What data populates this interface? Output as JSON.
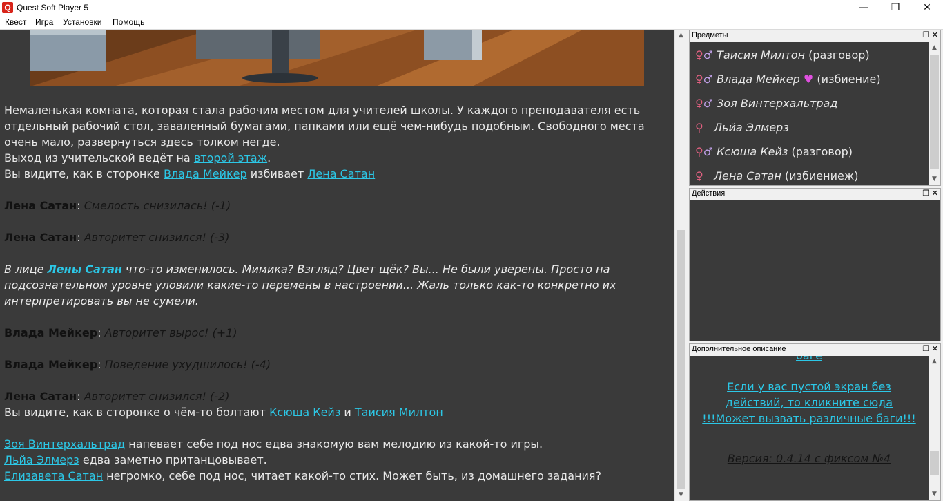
{
  "window": {
    "title": "Quest Soft Player 5",
    "icon": "quest-logo-icon",
    "controls": [
      "—",
      "❐",
      "✕"
    ]
  },
  "menu": [
    "Квест",
    "Игра",
    "Установки",
    "Помощь"
  ],
  "scene_image": "office-room-image",
  "story": {
    "desc1": "Немаленькая комната, которая стала рабочим местом для учителей школы. У каждого преподавателя есть отдельный рабочий стол, заваленный бумагами, папками или ещё чем-нибудь подобным. Свободного места очень мало, развернуться здесь толком негде.",
    "exit_prefix": "Выход из учительской ведёт на ",
    "exit_link": "второй этаж",
    "exit_suffix": ".",
    "see1_prefix": "Вы видите, как в сторонке ",
    "see1_name1": "Влада Мейкер",
    "see1_mid": " избивает ",
    "see1_name2": "Лена Сатан",
    "e1_name": "Лена Сатан",
    "e1_text": "Смелость снизилась! (-1)",
    "e2_name": "Лена Сатан",
    "e2_text": "Авторитет снизился! (-3)",
    "face_prefix": "В лице ",
    "face_link1": "Лены",
    "face_link2": "Сатан",
    "face_text": " что-то изменилось. Мимика? Взгляд? Цвет щёк? Вы... Не были уверены. Просто на подсознательном уровне уловили какие-то перемены в настроении... Жаль только как-то конкретно их интерпретировать вы не сумели.",
    "e3_name": "Влада Мейкер",
    "e3_text": "Авторитет вырос! (+1)",
    "e4_name": "Влада Мейкер",
    "e4_text": "Поведение ухудшилось! (-4)",
    "e5_name": "Лена Сатан",
    "e5_text": "Авторитет снизился! (-2)",
    "see2_prefix": "Вы видите, как в сторонке о чём-то болтают ",
    "see2_name1": "Ксюша Кейз",
    "see2_mid": " и ",
    "see2_name2": "Таисия Милтон",
    "l1_name": "Зоя Винтерхальтрад",
    "l1_text": " напевает себе под нос едва знакомую вам мелодию из какой-то игры.",
    "l2_name": "Льйа Элмерз",
    "l2_text": " едва заметно пританцовывает.",
    "l3_name": "Елизавета Сатан",
    "l3_text": " негромко, себе под нос, читает какой-то стих. Может быть, из домашнего задания?"
  },
  "panels": {
    "items_title": "Предметы",
    "actions_title": "Действия",
    "extra_title": "Дополнительное описание",
    "panel_buttons": "❐ ✕"
  },
  "items": [
    {
      "name": "Таисия Милтон",
      "suffix": " (разговор)",
      "icons": "female-male"
    },
    {
      "name": "Влада Мейкер",
      "suffix": " (избиение)",
      "icons": "female-male",
      "heart": "♥"
    },
    {
      "name": "Зоя Винтерхальтрад",
      "suffix": "",
      "icons": "female-male"
    },
    {
      "name": "Льйа Элмерз",
      "suffix": "",
      "icons": "female"
    },
    {
      "name": "Ксюша Кейз",
      "suffix": " (разговор)",
      "icons": "female-male"
    },
    {
      "name": "Лена Сатан",
      "suffix": " (избиениеж)",
      "icons": "female"
    }
  ],
  "extra": {
    "cut_link": "баге",
    "link1": "Если у вас пустой экран без действий, то кликните сюда",
    "link2": "!!!Может вызвать различные баги!!!",
    "version": "Версия: 0.4.14 с фиксом №4"
  },
  "colors": {
    "link": "#2cc7e6",
    "panel_bg": "#3a3a3a"
  }
}
